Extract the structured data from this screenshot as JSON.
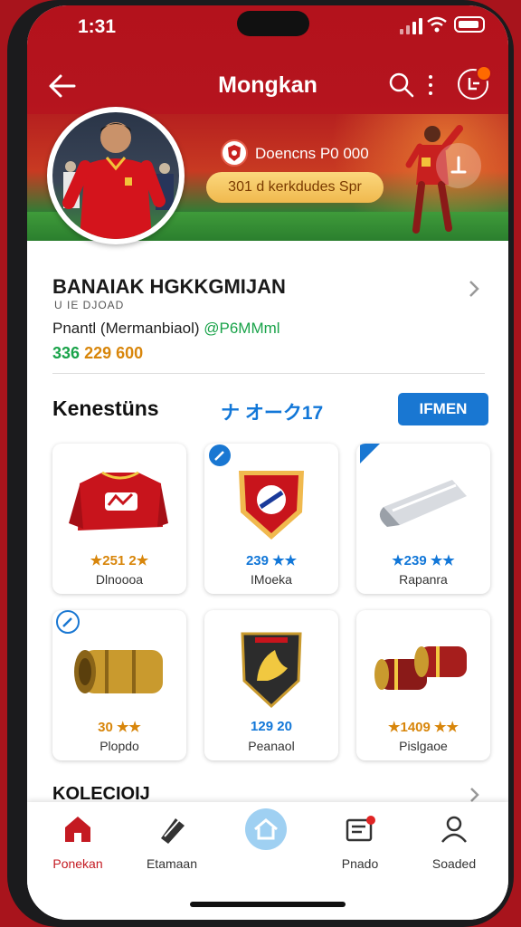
{
  "status": {
    "time": "1:31"
  },
  "header": {
    "title": "Mongkan"
  },
  "banner": {
    "club_text": "Doencns P0 000",
    "pill_text": "301 d kerkdudes Spr"
  },
  "profile": {
    "name": "BANAIAK HGKKGMIJAN",
    "subtitle": "U IE DJOAD",
    "handle_label": "Pnantl (Mermanbiaol)",
    "handle": "@P6MMml",
    "money_a": "336",
    "money_b": "229 600"
  },
  "section": {
    "title": "Kenestüns",
    "code": "ナ オーク17",
    "button_label": "IFMEN"
  },
  "items": [
    {
      "price": "★251 2★",
      "name": "Dlnoooa",
      "price_color": "#d8860b"
    },
    {
      "price": "239 ★★",
      "name": "IMoeka",
      "price_color": "#1277d8"
    },
    {
      "price": "★239 ★★",
      "name": "Rapanra",
      "price_color": "#1277d8"
    },
    {
      "price": "30 ★★",
      "name": "Plopdo",
      "price_color": "#d8860b"
    },
    {
      "price": "129 20",
      "name": "Peanaol",
      "price_color": "#1277d8"
    },
    {
      "price": "★1409 ★★",
      "name": "Pislgaoe",
      "price_color": "#d8860b"
    }
  ],
  "collection": {
    "title": "KOLECIOIJ"
  },
  "tabs": [
    {
      "label": "Ponekan",
      "icon": "home-icon"
    },
    {
      "label": "Etamaan",
      "icon": "ticket-icon"
    },
    {
      "label": "",
      "icon": "stadium-icon"
    },
    {
      "label": "Pnado",
      "icon": "inbox-icon"
    },
    {
      "label": "Soaded",
      "icon": "profile-icon"
    }
  ],
  "colors": {
    "brand_red": "#b3121c",
    "accent_blue": "#1977d2",
    "gold": "#f0b94e",
    "green": "#1aa34a"
  }
}
